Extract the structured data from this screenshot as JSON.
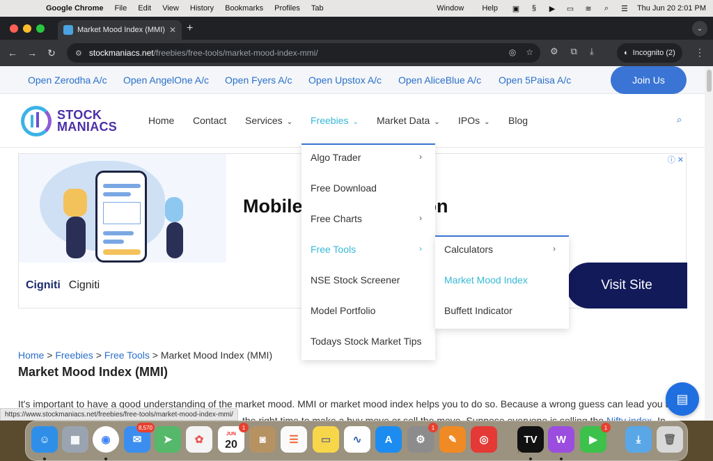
{
  "menubar": {
    "app_name": "Google Chrome",
    "menus": [
      "File",
      "Edit",
      "View",
      "History",
      "Bookmarks",
      "Profiles",
      "Tab"
    ],
    "right_menus": [
      "Window",
      "Help"
    ],
    "datetime": "Thu Jun 20  2:01 PM"
  },
  "browser": {
    "tab_title": "Market Mood Index (MMI) - S",
    "url_host": "stockmaniacs.net",
    "url_path": "/freebies/free-tools/market-mood-index-mmi/",
    "incognito_label": "Incognito (2)",
    "status_url": "https://www.stockmaniacs.net/freebies/free-tools/market-mood-index-mmi/"
  },
  "topbar": {
    "brokers": [
      "Open Zerodha A/c",
      "Open AngelOne A/c",
      "Open Fyers A/c",
      "Open Upstox A/c",
      "Open AliceBlue A/c",
      "Open 5Paisa A/c"
    ],
    "join_label": "Join Us"
  },
  "logo": {
    "line1": "STOCK",
    "line2": "MANIACS"
  },
  "nav": {
    "home": "Home",
    "contact": "Contact",
    "services": "Services",
    "freebies": "Freebies",
    "market_data": "Market Data",
    "ipos": "IPOs",
    "blog": "Blog"
  },
  "freebies_menu": {
    "items": [
      "Algo Trader",
      "Free Download",
      "Free Charts",
      "Free Tools",
      "NSE Stock Screener",
      "Model Portfolio",
      "Todays Stock Market Tips"
    ]
  },
  "free_tools_menu": {
    "items": [
      "Calculators",
      "Market Mood Index",
      "Buffett Indicator"
    ]
  },
  "ad": {
    "headline_left": "Mobile",
    "headline_right": "on",
    "brand_logo": "Cigniti",
    "brand_name": "Cigniti",
    "cta": "Visit Site"
  },
  "breadcrumb": {
    "home": "Home",
    "freebies": "Freebies",
    "free_tools": "Free Tools",
    "current": "Market Mood Index (MMI)",
    "separator": ">"
  },
  "content": {
    "title": "Market Mood Index (MMI)",
    "line1": "It's important to have a good understanding of the market mood. MMI or market mood index helps you to do so. Because a wrong guess can lead you to a",
    "line2_start": "the right time to make a buy move or sell the move. Suppose everyone is selling the ",
    "nifty_link": "Nifty index",
    "line2_end": ". In such a"
  },
  "dock": {
    "mail_badge": "8,570",
    "calendar_month": "JUN",
    "calendar_day": "20",
    "calendar_badge": "1",
    "settings_badge": "1",
    "facetime_badge": "1"
  }
}
